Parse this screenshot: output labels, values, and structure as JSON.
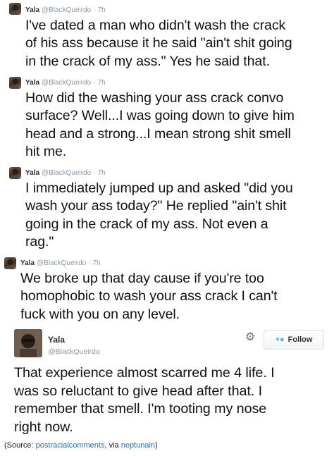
{
  "tweets": [
    {
      "name": "Yala",
      "handle": "@BlackQueirdo",
      "time": "7h",
      "lines": [
        "I've dated a man who didn't wash the crack",
        "of his ass because it he said \"ain't shit going",
        "in the crack of my ass.\" Yes he said that."
      ]
    },
    {
      "name": "Yala",
      "handle": "@BlackQueirdo",
      "time": "7h",
      "lines": [
        "How did the washing your ass crack convo",
        "surface? Well...I was going down to give him",
        "head and a strong...I mean strong shit smell",
        "hit me."
      ]
    },
    {
      "name": "Yala",
      "handle": "@BlackQueirdo",
      "time": "7h",
      "lines": [
        "I immediately jumped up and asked \"did you",
        "wash your ass today?\" He replied \"ain't shit",
        "going in the crack of my ass. Not even a",
        "rag.\""
      ]
    },
    {
      "name": "Yala",
      "handle": "@BlackQueirdo",
      "time": "7h",
      "lines": [
        "We broke up that day cause if you're too",
        "homophobic to wash your ass crack I can't",
        "fuck with you on any level."
      ]
    }
  ],
  "expanded_tweet": {
    "name": "Yala",
    "handle": "@BlackQueirdo",
    "follow_label": "Follow",
    "lines": [
      "That experience almost scarred me 4 life. I",
      "was so reluctant to give head after that. I",
      "remember that smell. I'm tooting my nose",
      "right now."
    ]
  },
  "source": {
    "prefix": "(Source: ",
    "link1": "postracialcomments",
    "middle": ", via ",
    "link2": "neptunain",
    "suffix": ")"
  },
  "icons": {
    "settings": "gear-icon",
    "follow": "add-user-icon"
  }
}
